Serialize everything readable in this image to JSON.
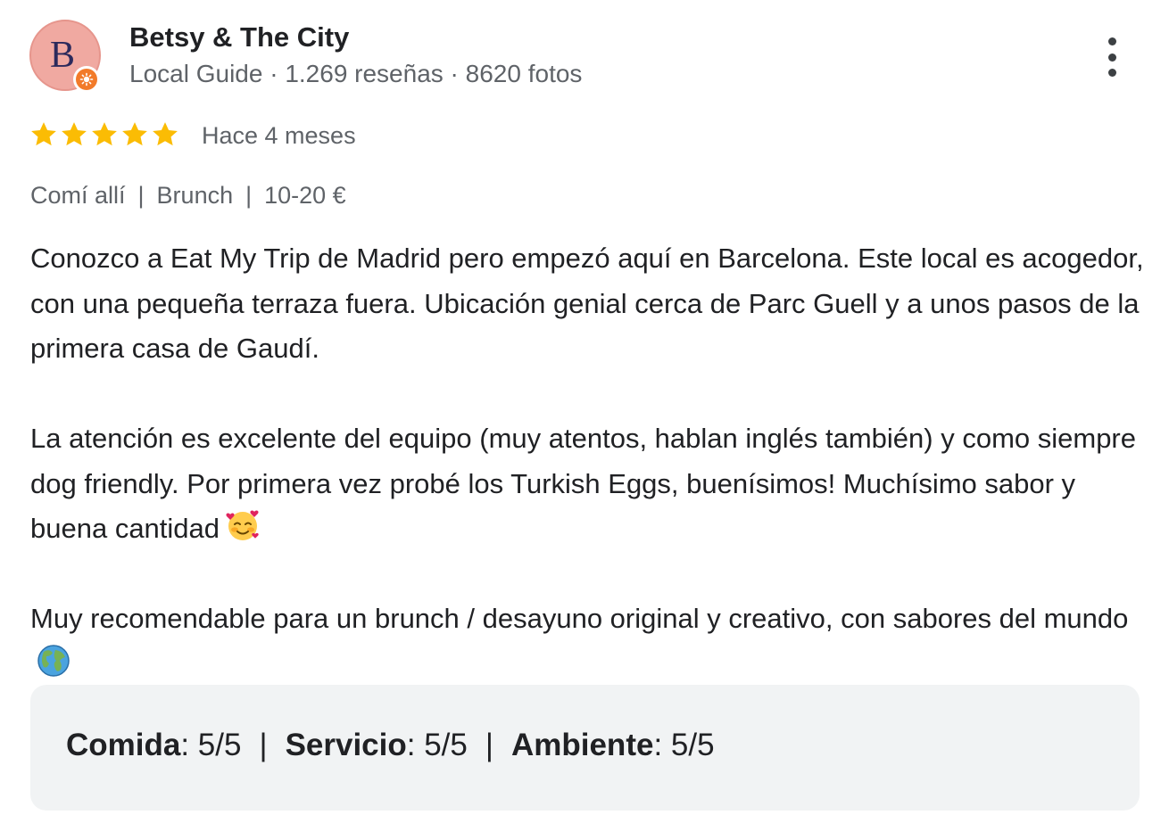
{
  "author": {
    "avatar_letter": "B",
    "name": "Betsy & The City",
    "meta": "Local Guide · 1.269 reseñas · 8620 fotos",
    "badge_icon": "local-guide-badge-icon"
  },
  "review": {
    "rating": 5,
    "rating_max": 5,
    "time_ago": "Hace 4 meses",
    "tags": [
      "Comí allí",
      "Brunch",
      "10-20 €"
    ],
    "tag_separator": "|",
    "paragraphs": [
      "Conozco a Eat My Trip de Madrid pero empezó aquí en Barcelona. Este local es acogedor, con una pequeña terraza fuera. Ubicación genial cerca de Parc Guell y a unos pasos de la primera casa de Gaudí.",
      "La atención es excelente del equipo (muy atentos, hablan inglés también) y como siempre dog friendly. Por primera vez probé los Turkish Eggs, buenísimos! Muchísimo sabor y buena cantidad",
      "Muy recomendable para un brunch / desayuno original y creativo, con sabores del mundo"
    ],
    "paragraph_emojis": [
      "",
      "smiling-face-with-hearts-emoji",
      "globe-emoji"
    ]
  },
  "attributes": {
    "separator": "|",
    "items": [
      {
        "name": "Comida",
        "value": ": 5/5"
      },
      {
        "name": "Servicio",
        "value": ": 5/5"
      },
      {
        "name": "Ambiente",
        "value": ": 5/5"
      }
    ]
  },
  "colors": {
    "star": "#fbbc04",
    "avatar_bg": "#f0a9a1",
    "badge": "#f27b2a",
    "secondary_text": "#5f6368",
    "attributes_bg": "#f1f3f4"
  },
  "icons": {
    "more": "more-vert-icon",
    "star": "star-icon"
  }
}
